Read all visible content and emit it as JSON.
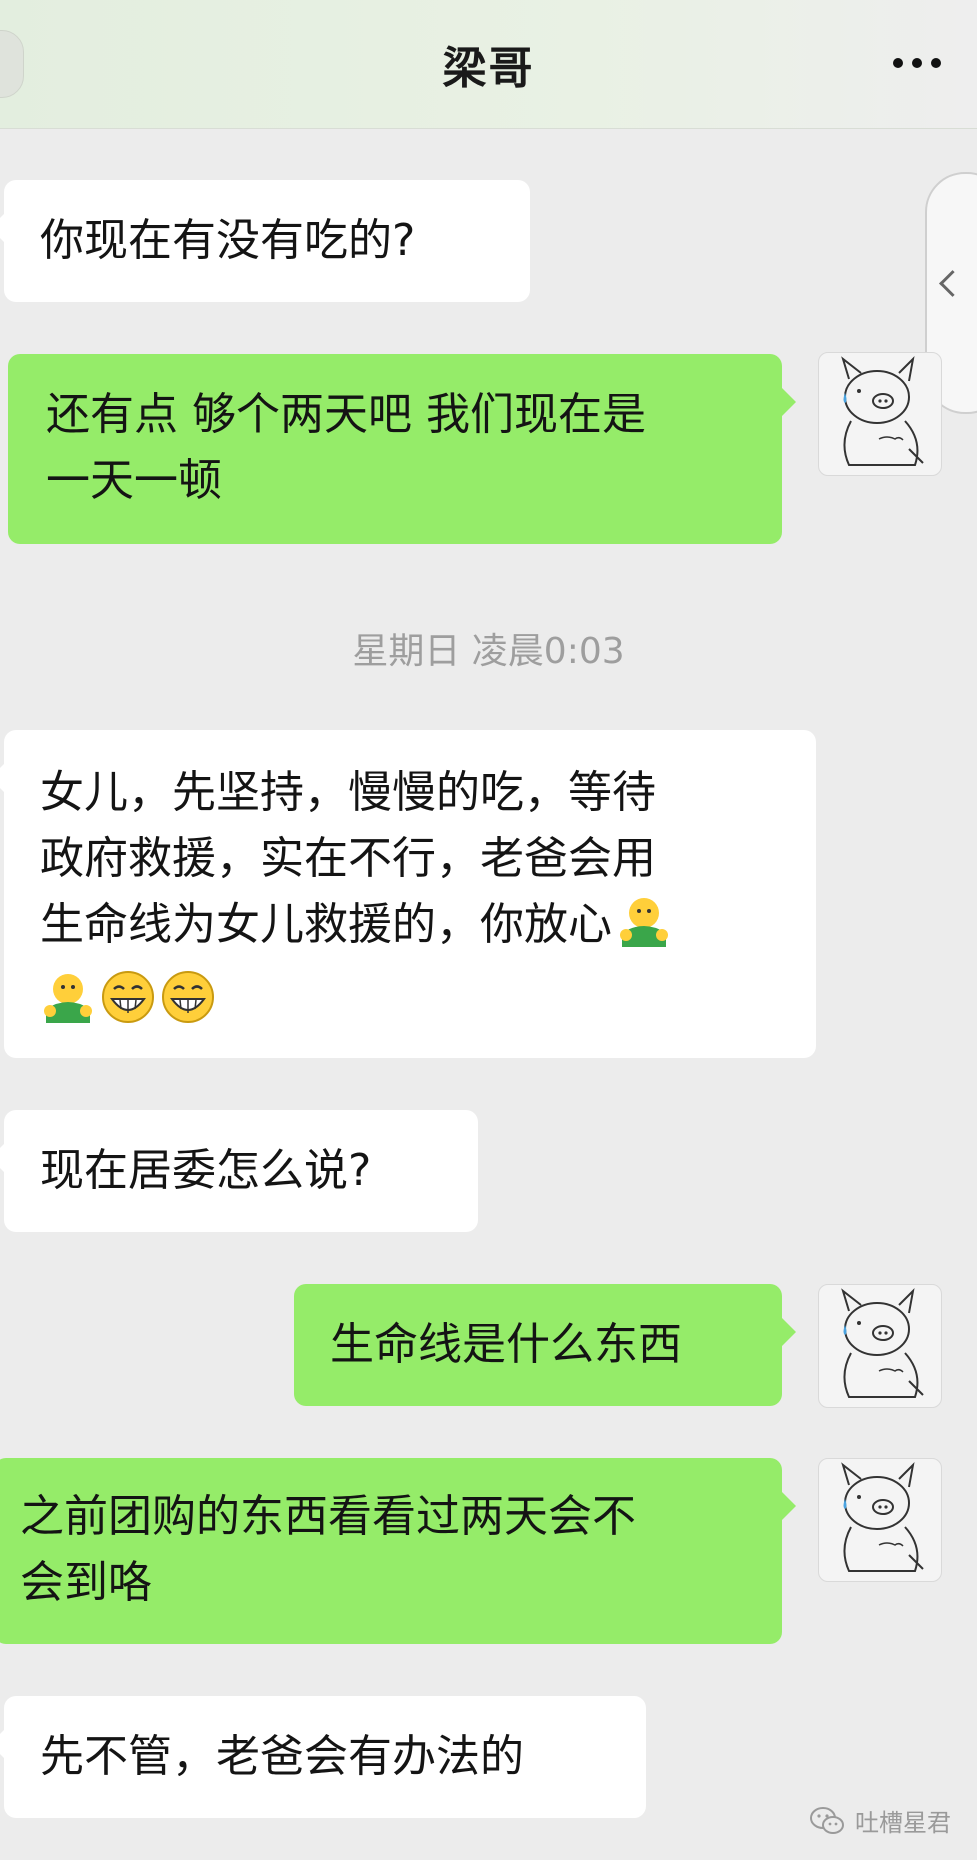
{
  "header": {
    "title": "梁哥",
    "more_icon": "more-dots-icon",
    "back_icon": "back-nub-icon"
  },
  "side_tab": {
    "icon": "chevron-left-icon"
  },
  "timestamp": "星期日 凌晨0:03",
  "messages": [
    {
      "side": "in",
      "lines": [
        "你现在有没有吃的?"
      ]
    },
    {
      "side": "out",
      "lines": [
        "还有点 够个两天吧 我们现在是",
        "一天一顿"
      ],
      "avatar": "pig-sketch-avatar"
    },
    {
      "side": "in",
      "lines": [
        "女儿，先坚持，慢慢的吃，等待",
        "政府救援，实在不行，老爸会用",
        "生命线为女儿救援的，你放心"
      ],
      "emojis": [
        "hug-emoji",
        "hug-emoji",
        "grin-emoji",
        "grin-emoji"
      ]
    },
    {
      "side": "in",
      "lines": [
        "现在居委怎么说?"
      ]
    },
    {
      "side": "out",
      "lines": [
        "生命线是什么东西"
      ],
      "avatar": "pig-sketch-avatar"
    },
    {
      "side": "out",
      "lines": [
        "之前团购的东西看看过两天会不",
        "会到咯"
      ],
      "avatar": "pig-sketch-avatar"
    },
    {
      "side": "in",
      "lines": [
        "先不管，老爸会有办法的"
      ]
    }
  ],
  "watermark": {
    "icon": "wechat-icon",
    "text": "吐槽星君"
  },
  "colors": {
    "outgoing": "#95ec69",
    "incoming": "#ffffff",
    "background": "#ececec"
  }
}
